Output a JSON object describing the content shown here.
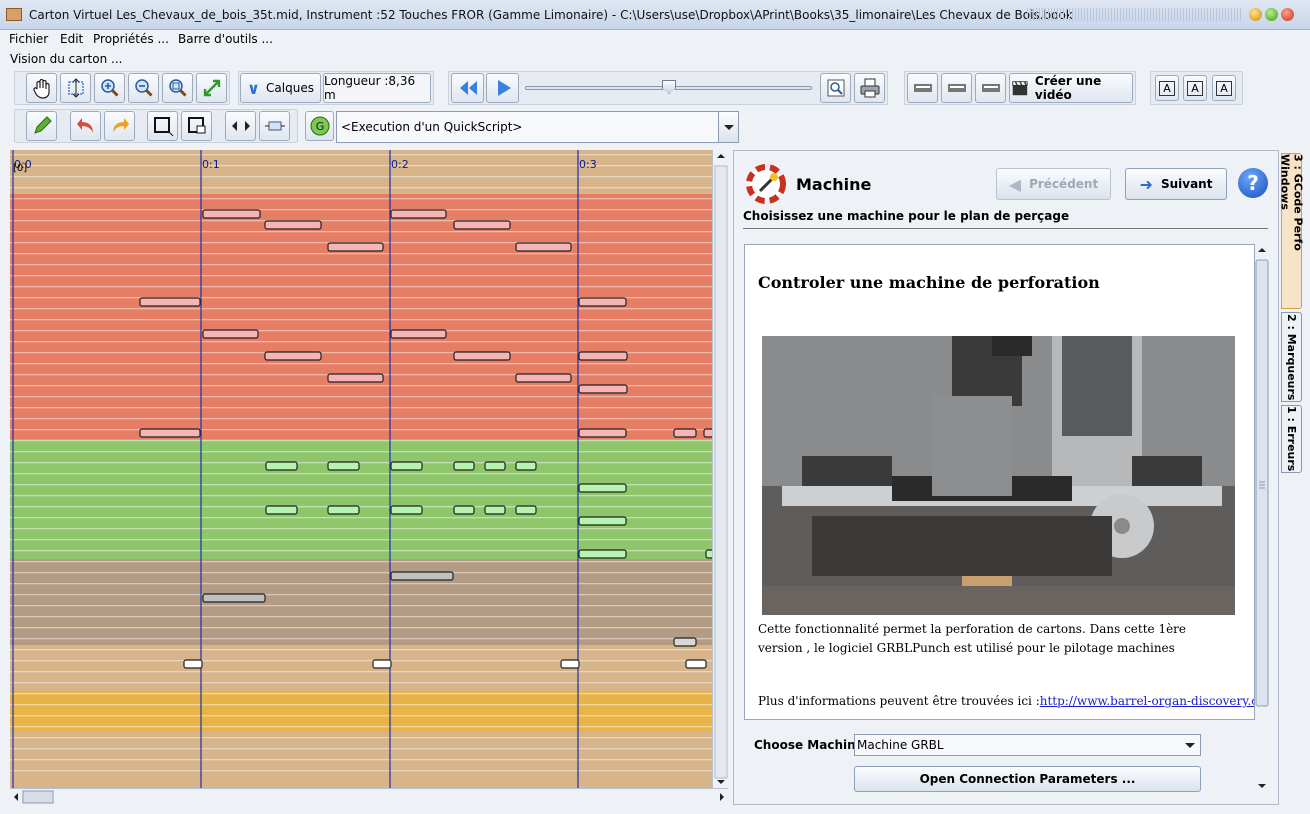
{
  "window": {
    "title": "Carton Virtuel  Les_Chevaux_de_bois_35t.mid, Instrument :52 Touches FROR (Gamme Limonaire) - C:\\Users\\use\\Dropbox\\APrint\\Books\\35_limonaire\\Les Chevaux de Bois.book"
  },
  "menu": [
    "Fichier",
    "Edit",
    "Propriétés ...",
    "Barre d'outils ..."
  ],
  "vision_label": "Vision du carton ...",
  "toolbar": {
    "calques": "Calques",
    "longueur": "Longueur :8,36 m",
    "create_video": "Créer une vidéo",
    "quickscript": "<Execution d'un QuickScript>"
  },
  "carton": {
    "time_marks": [
      "0:0",
      "0:1",
      "0:2",
      "0:3"
    ],
    "zero_label": "[0]"
  },
  "wizard": {
    "title": "Machine",
    "subtitle": "Choisissez une machine pour le plan de perçage",
    "prev": "Précédent",
    "next": "Suivant",
    "doc_heading": "Controler une machine de perforation",
    "doc_p1": "Cette fonctionnalité permet la perforation de cartons. Dans cette 1ère version , le logiciel GRBLPunch est utilisé pour le pilotage machines",
    "doc_p2_prefix": "Plus d'informations peuvent être trouvées ici :",
    "doc_link": "http://www.barrel-organ-discovery.org",
    "choose_label": "Choose Machine :",
    "machine": "Machine GRBL",
    "open_params": "Open Connection Parameters ..."
  },
  "side_tabs": [
    "3 : GCode Perfo Windows",
    "2 : Marqueurs",
    "1 : Erreurs"
  ],
  "colors": {
    "red_band": "#e57e64",
    "green_band": "#8fc66b",
    "brown_band": "#b49c84",
    "tan": "#d8b48a",
    "yellow": "#e8b44a",
    "accent": "#2a6fd6"
  }
}
